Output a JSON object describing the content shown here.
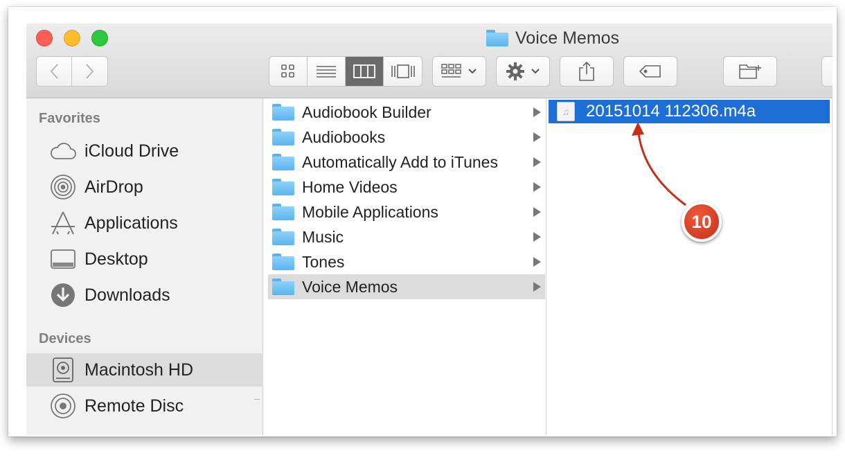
{
  "window": {
    "title": "Voice Memos"
  },
  "sidebar": {
    "sections": [
      {
        "header": "Favorites",
        "items": [
          {
            "label": "iCloud Drive",
            "icon": "cloud-icon"
          },
          {
            "label": "AirDrop",
            "icon": "airdrop-icon"
          },
          {
            "label": "Applications",
            "icon": "applications-icon"
          },
          {
            "label": "Desktop",
            "icon": "desktop-icon"
          },
          {
            "label": "Downloads",
            "icon": "downloads-icon"
          }
        ]
      },
      {
        "header": "Devices",
        "items": [
          {
            "label": "Macintosh HD",
            "icon": "hard-drive-icon",
            "selected": true
          },
          {
            "label": "Remote Disc",
            "icon": "disc-icon"
          }
        ]
      }
    ]
  },
  "column1": {
    "items": [
      {
        "label": "Audiobook Builder"
      },
      {
        "label": "Audiobooks"
      },
      {
        "label": "Automatically Add to iTunes"
      },
      {
        "label": "Home Videos"
      },
      {
        "label": "Mobile Applications"
      },
      {
        "label": "Music"
      },
      {
        "label": "Tones"
      },
      {
        "label": "Voice Memos",
        "selected": true
      }
    ]
  },
  "column2": {
    "items": [
      {
        "label": "20151014 112306.m4a",
        "icon": "audio-file-icon",
        "selected": true
      }
    ]
  },
  "annotation": {
    "badge": "10",
    "color": "#c62f17"
  },
  "colors": {
    "selection": "#1d6fd6",
    "close": "#fc5f57",
    "minimize": "#fdbc2e",
    "zoom": "#2bc840"
  }
}
